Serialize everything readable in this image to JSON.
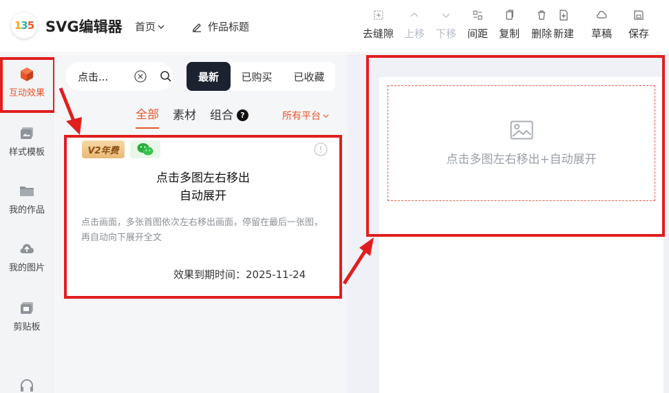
{
  "header": {
    "logo_text": [
      "1",
      "3",
      "5"
    ],
    "app_title": "SVG编辑器",
    "home_label": "首页",
    "work_title_label": "作品标题"
  },
  "toolbar": {
    "tools": [
      {
        "label": "去缝隙",
        "icon": "gap-icon",
        "disabled": false
      },
      {
        "label": "上移",
        "icon": "chevron-up-icon",
        "disabled": true
      },
      {
        "label": "下移",
        "icon": "chevron-down-icon",
        "disabled": true
      },
      {
        "label": "间距",
        "icon": "spacing-icon",
        "disabled": false
      },
      {
        "label": "复制",
        "icon": "copy-icon",
        "disabled": false
      },
      {
        "label": "删除",
        "icon": "trash-icon",
        "disabled": false
      },
      {
        "label": "新建",
        "icon": "new-file-icon",
        "disabled": false
      },
      {
        "label": "草稿",
        "icon": "cloud-icon",
        "disabled": false
      },
      {
        "label": "保存",
        "icon": "save-icon",
        "disabled": false
      }
    ]
  },
  "sidebar": {
    "items": [
      {
        "label": "互动效果",
        "icon": "cube-icon",
        "active": true
      },
      {
        "label": "样式模板",
        "icon": "template-icon",
        "active": false
      },
      {
        "label": "我的作品",
        "icon": "folder-icon",
        "active": false
      },
      {
        "label": "我的图片",
        "icon": "cloud-upload-icon",
        "active": false
      },
      {
        "label": "剪贴板",
        "icon": "clipboard-icon",
        "active": false
      }
    ]
  },
  "panel": {
    "search": {
      "value": "点击..."
    },
    "sort_tabs": [
      "最新",
      "已购买",
      "已收藏"
    ],
    "category_tabs": [
      "全部",
      "素材",
      "组合"
    ],
    "help_mark": "?",
    "platform_filter": "所有平台",
    "card": {
      "badge_v2": "V2年费",
      "title_line1": "点击多图左右移出",
      "title_line2": "自动展开",
      "description": "点击画面，多张首图依次左右移出画面，停留在最后一张图，再自动向下展开全文",
      "expire": "效果到期时间：2025-11-24"
    }
  },
  "canvas": {
    "placeholder_text": "点击多图左右移出+自动展开"
  },
  "colors": {
    "accent": "#e8552b",
    "highlight": "#e01e1e",
    "dark_button": "#1b2330"
  }
}
